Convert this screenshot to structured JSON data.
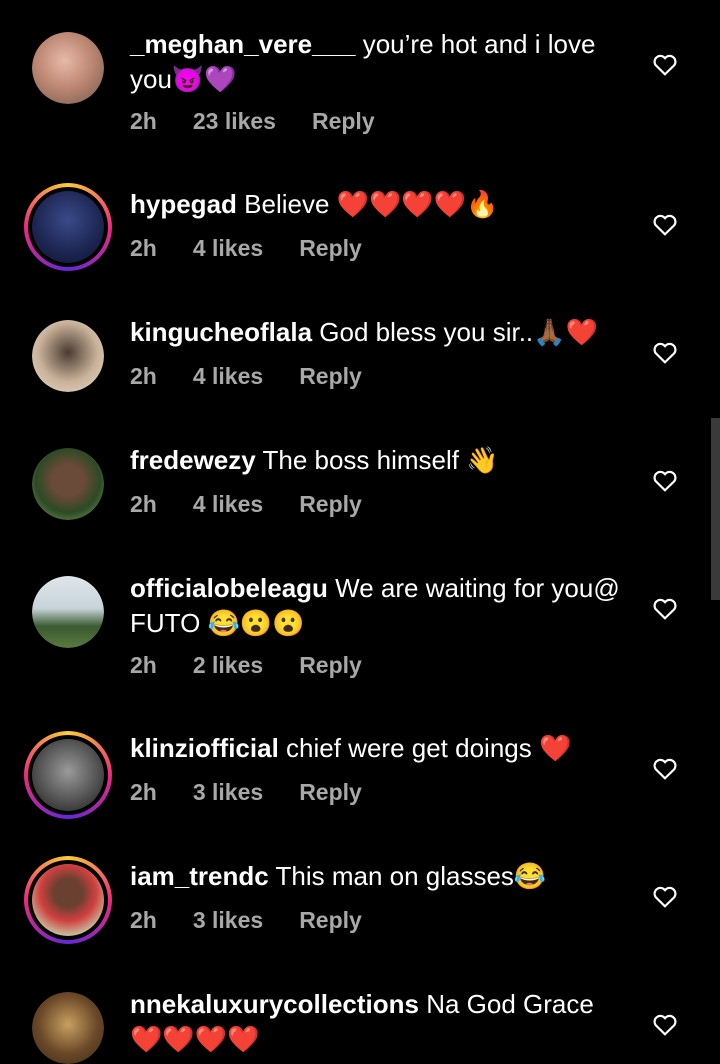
{
  "comments": [
    {
      "user": "_meghan_vere___",
      "text": " you’re hot and i love you😈💜",
      "time": "2h",
      "likes": "23 likes",
      "reply": "Reply"
    },
    {
      "user": "hypegad",
      "text": " Believe ❤️❤️❤️❤️🔥",
      "time": "2h",
      "likes": "4 likes",
      "reply": "Reply"
    },
    {
      "user": "kingucheoflala",
      "text": " God bless you sir..🙏🏾❤️",
      "time": "2h",
      "likes": "4 likes",
      "reply": "Reply"
    },
    {
      "user": "fredewezy",
      "text": " The boss himself 👋",
      "time": "2h",
      "likes": "4 likes",
      "reply": "Reply"
    },
    {
      "user": "officialobeleagu",
      "text": " We are waiting for you@ FUTO 😂😮😮",
      "time": "2h",
      "likes": "2 likes",
      "reply": "Reply"
    },
    {
      "user": "klinziofficial",
      "text": " chief were get doings ❤️",
      "time": "2h",
      "likes": "3 likes",
      "reply": "Reply"
    },
    {
      "user": "iam_trendc",
      "text": " This man on glasses😂",
      "time": "2h",
      "likes": "3 likes",
      "reply": "Reply"
    },
    {
      "user": "nnekaluxurycollections",
      "text": " Na God Grace ❤️❤️❤️❤️",
      "time": "",
      "likes": "",
      "reply": ""
    }
  ]
}
